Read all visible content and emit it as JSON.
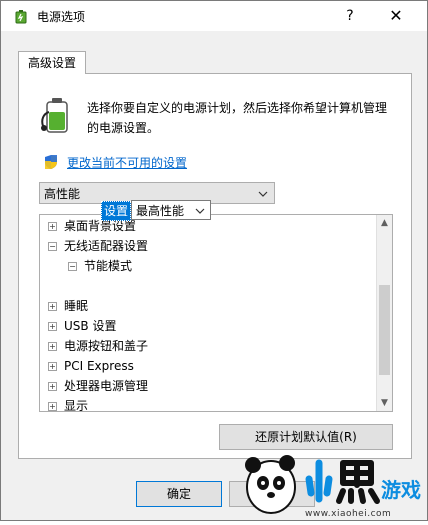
{
  "window": {
    "title": "电源选项",
    "help_label": "?",
    "close_label": "✕"
  },
  "tab": {
    "label": "高级设置"
  },
  "description": "选择你要自定义的电源计划，然后选择你希望计算机管理的电源设置。",
  "change_link": "更改当前不可用的设置",
  "plan_select": {
    "value": "高性能"
  },
  "tree": {
    "items": [
      {
        "label": "桌面背景设置",
        "expander": "+"
      },
      {
        "label": "无线适配器设置",
        "expander": "−"
      },
      {
        "label": "节能模式",
        "expander": "−"
      },
      {
        "label": "睡眠",
        "expander": "+"
      },
      {
        "label": "USB 设置",
        "expander": "+"
      },
      {
        "label": "电源按钮和盖子",
        "expander": "+"
      },
      {
        "label": "PCI Express",
        "expander": "+"
      },
      {
        "label": "处理器电源管理",
        "expander": "+"
      },
      {
        "label": "显示",
        "expander": "+"
      }
    ],
    "setting_label": "设置",
    "setting_value": "最高性能"
  },
  "buttons": {
    "restore": "还原计划默认值(R)",
    "ok": "确定",
    "cancel": "取消"
  },
  "watermark": {
    "site": "www.xiaohei.com",
    "brand": "小黑游戏"
  },
  "colors": {
    "accent": "#0078d7",
    "link": "#0066cc",
    "selection": "#0078d7"
  },
  "icons": [
    "power-options-icon",
    "battery-plan-icon",
    "uac-shield-icon",
    "chevron-down-icon",
    "scroll-up-icon",
    "scroll-down-icon"
  ]
}
